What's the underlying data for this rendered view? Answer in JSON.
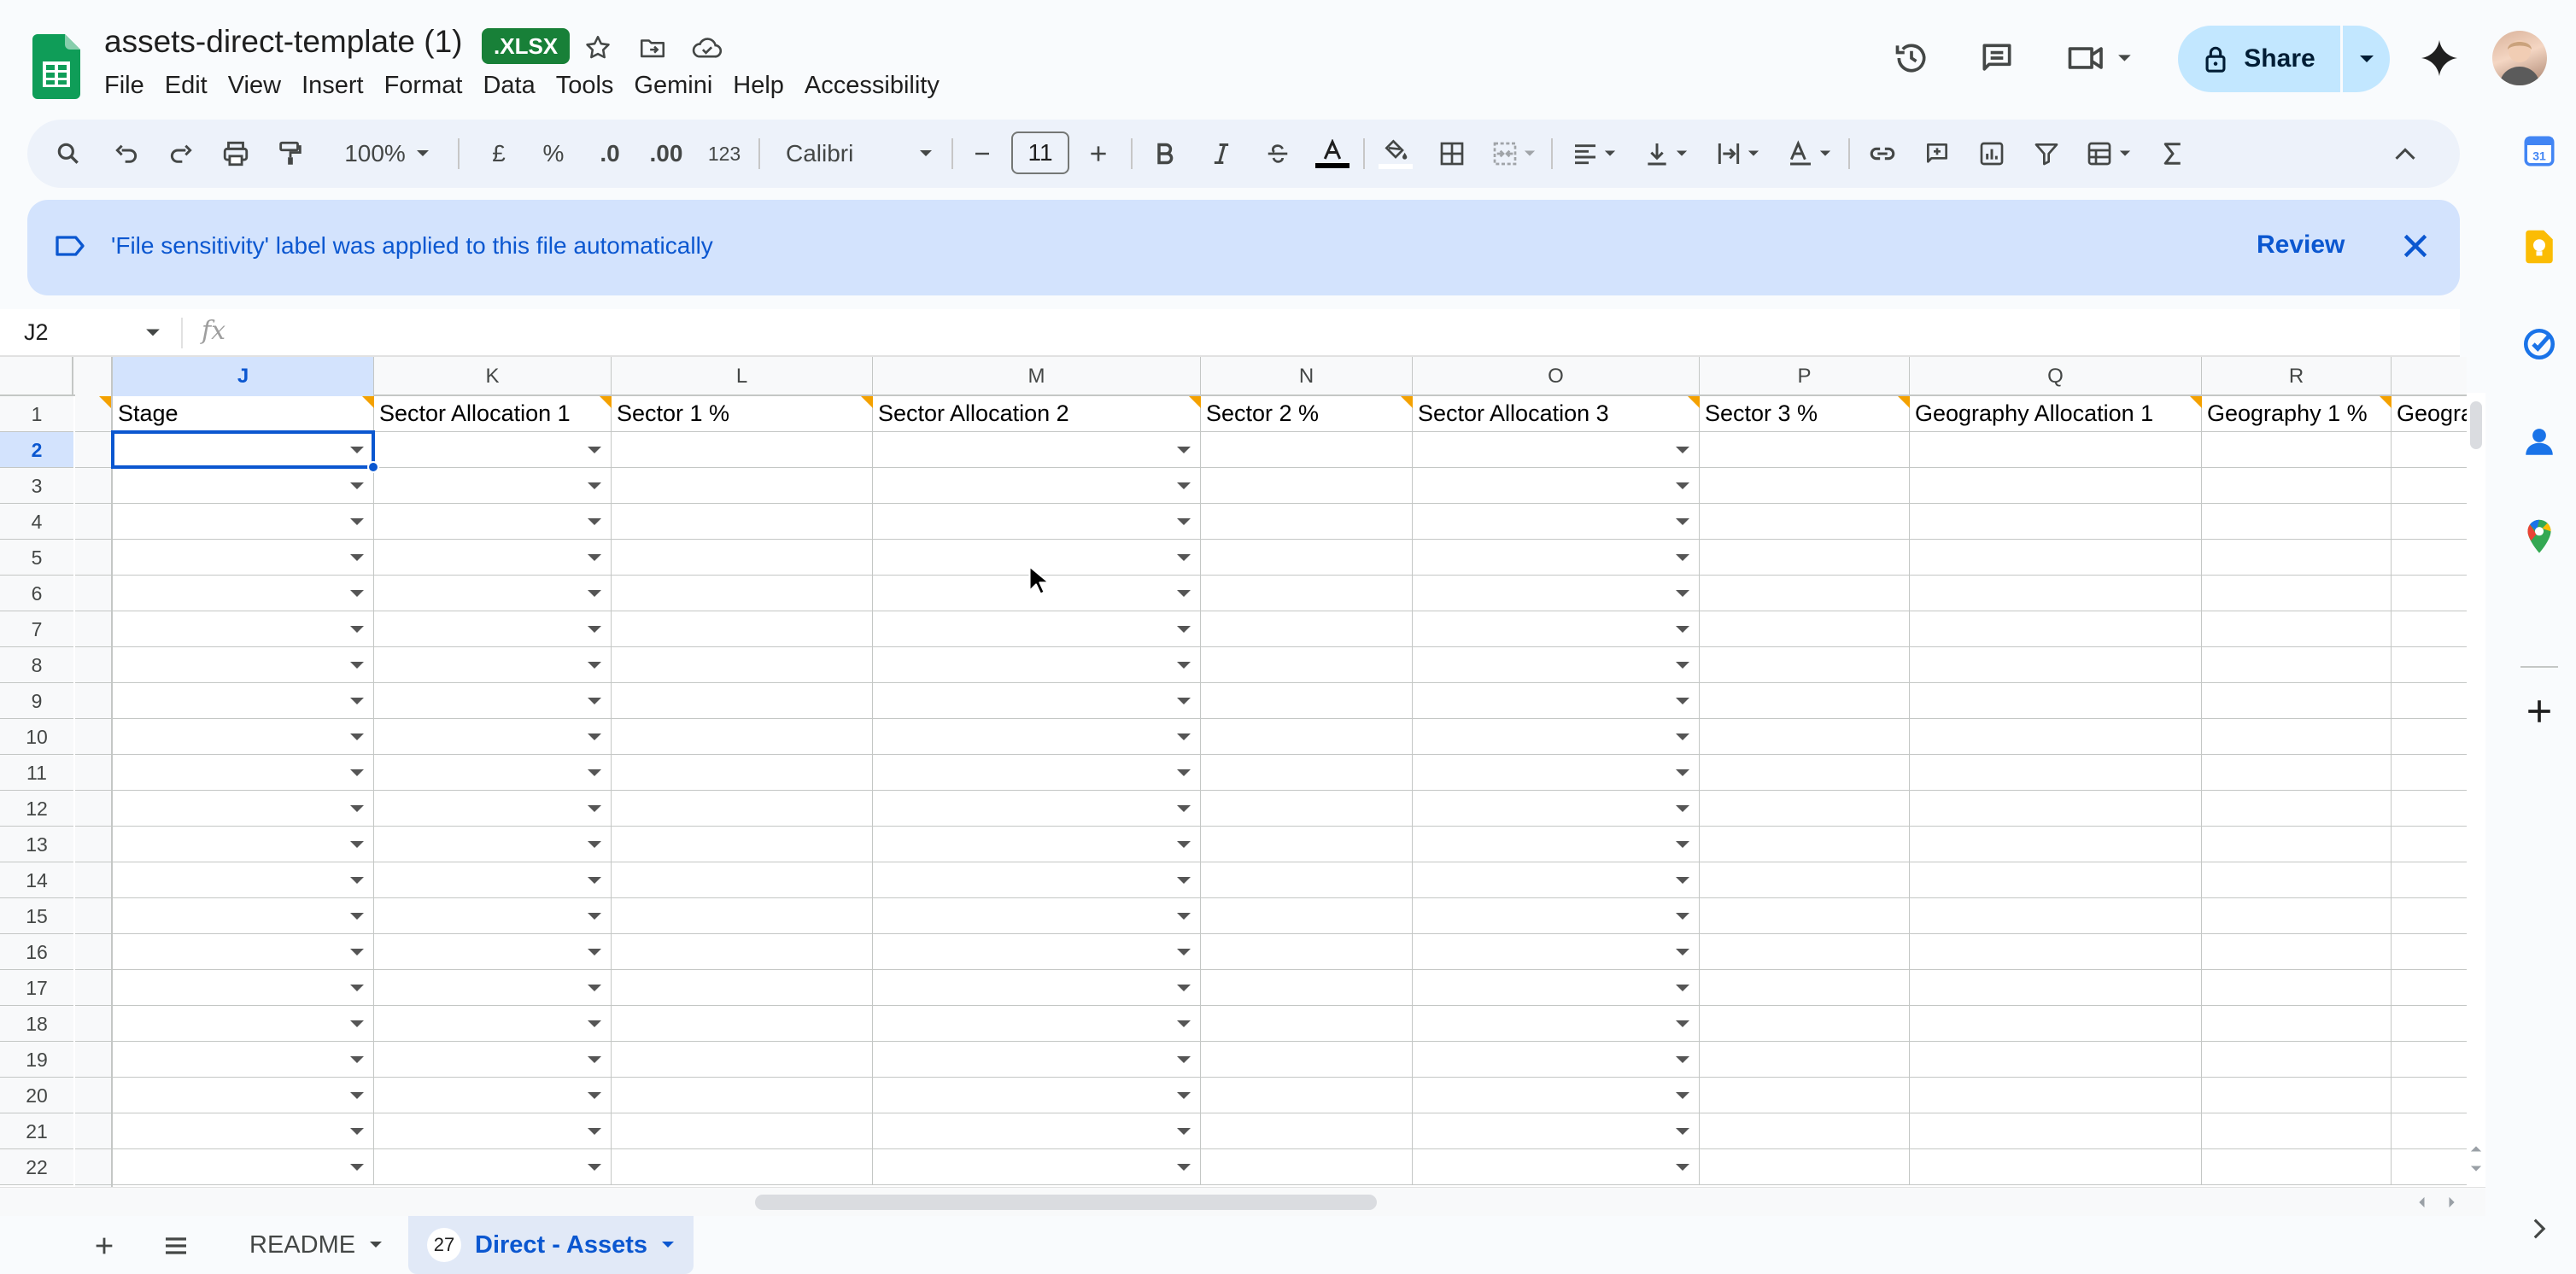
{
  "doc": {
    "title": "assets-direct-template (1)",
    "format_badge": ".XLSX"
  },
  "menu": [
    "File",
    "Edit",
    "View",
    "Insert",
    "Format",
    "Data",
    "Tools",
    "Gemini",
    "Help",
    "Accessibility"
  ],
  "share": {
    "label": "Share"
  },
  "toolbar": {
    "zoom": "100%",
    "currency": "£",
    "percent": "%",
    "dec_decrease": ".0",
    "dec_increase": ".00",
    "more_formats": "123",
    "font": "Calibri",
    "font_size": "11",
    "text_color": "#000000"
  },
  "banner": {
    "message": "'File sensitivity' label was applied to this file automatically",
    "action": "Review"
  },
  "formula_bar": {
    "cell_ref": "J2",
    "fx": "fx",
    "content": ""
  },
  "grid": {
    "selected_column": "J",
    "selected_row": "2",
    "columns": [
      {
        "letter": "J",
        "header": "Stage",
        "dropdown": true
      },
      {
        "letter": "K",
        "header": "Sector Allocation 1",
        "dropdown": true
      },
      {
        "letter": "L",
        "header": "Sector 1 %",
        "dropdown": false
      },
      {
        "letter": "M",
        "header": "Sector Allocation 2",
        "dropdown": true
      },
      {
        "letter": "N",
        "header": "Sector 2 %",
        "dropdown": false
      },
      {
        "letter": "O",
        "header": "Sector Allocation 3",
        "dropdown": true
      },
      {
        "letter": "P",
        "header": "Sector 3 %",
        "dropdown": false
      },
      {
        "letter": "Q",
        "header": "Geography Allocation 1",
        "dropdown": false
      },
      {
        "letter": "R",
        "header": "Geography 1 %",
        "dropdown": false
      },
      {
        "letter": "",
        "header": "Geogra",
        "dropdown": false
      }
    ],
    "rows": [
      "1",
      "2",
      "3",
      "4",
      "5",
      "6",
      "7",
      "8",
      "9",
      "10",
      "11",
      "12",
      "13",
      "14",
      "15",
      "16",
      "17",
      "18",
      "19",
      "20",
      "21",
      "22"
    ]
  },
  "sheets": {
    "tabs": [
      {
        "name": "README",
        "active": false,
        "count": ""
      },
      {
        "name": "Direct - Assets",
        "active": true,
        "count": "27"
      }
    ]
  },
  "colors": {
    "accent": "#0b57d0",
    "banner_bg": "#d3e3fd",
    "share_bg": "#c2e7ff",
    "sheets_green": "#188038",
    "note_marker": "#f4a100"
  }
}
